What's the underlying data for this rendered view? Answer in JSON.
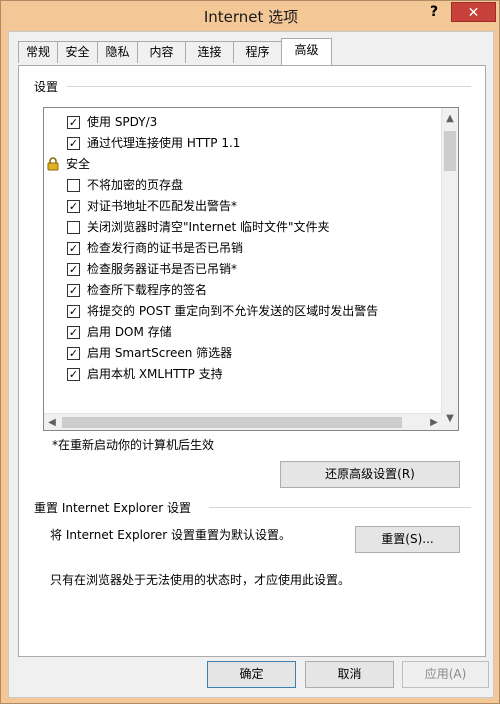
{
  "window": {
    "title": "Internet 选项",
    "help_label": "?",
    "close_label": "✕"
  },
  "tabs": [
    {
      "label": "常规"
    },
    {
      "label": "安全"
    },
    {
      "label": "隐私"
    },
    {
      "label": "内容"
    },
    {
      "label": "连接"
    },
    {
      "label": "程序"
    },
    {
      "label": "高级"
    }
  ],
  "active_tab": "高级",
  "settings": {
    "group_label": "设置",
    "items": [
      {
        "type": "checkbox",
        "checked": true,
        "label": "使用 SPDY/3"
      },
      {
        "type": "checkbox",
        "checked": true,
        "label": "通过代理连接使用 HTTP 1.1"
      },
      {
        "type": "category",
        "icon": "lock-icon",
        "label": "安全"
      },
      {
        "type": "checkbox",
        "checked": false,
        "label": "不将加密的页存盘"
      },
      {
        "type": "checkbox",
        "checked": true,
        "label": "对证书地址不匹配发出警告*"
      },
      {
        "type": "checkbox",
        "checked": false,
        "label": "关闭浏览器时清空\"Internet 临时文件\"文件夹"
      },
      {
        "type": "checkbox",
        "checked": true,
        "label": "检查发行商的证书是否已吊销"
      },
      {
        "type": "checkbox",
        "checked": true,
        "label": "检查服务器证书是否已吊销*"
      },
      {
        "type": "checkbox",
        "checked": true,
        "label": "检查所下载程序的签名"
      },
      {
        "type": "checkbox",
        "checked": true,
        "label": "将提交的 POST 重定向到不允许发送的区域时发出警告"
      },
      {
        "type": "checkbox",
        "checked": true,
        "label": "启用 DOM 存储"
      },
      {
        "type": "checkbox",
        "checked": true,
        "label": "启用 SmartScreen 筛选器"
      },
      {
        "type": "checkbox",
        "checked": true,
        "label": "启用本机 XMLHTTP 支持"
      }
    ],
    "restart_note": "*在重新启动你的计算机后生效",
    "restore_button": "还原高级设置(R)"
  },
  "reset": {
    "group_label": "重置 Internet Explorer 设置",
    "description": "将 Internet Explorer 设置重置为默认设置。",
    "reset_button": "重置(S)...",
    "warning": "只有在浏览器处于无法使用的状态时，才应使用此设置。"
  },
  "footer": {
    "ok": "确定",
    "cancel": "取消",
    "apply": "应用(A)"
  },
  "colors": {
    "title_bar": "#f4c796",
    "close_button": "#c7403a",
    "panel": "#ffffff"
  }
}
